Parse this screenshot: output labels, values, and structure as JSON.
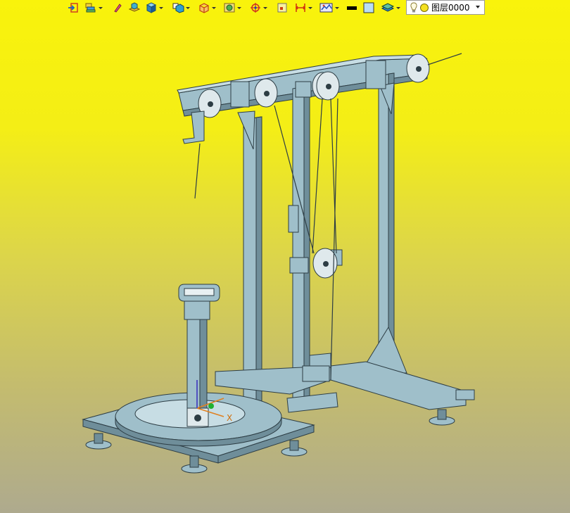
{
  "window": {
    "background_top": "#f9f30b",
    "background_bottom": "#aeaa8e"
  },
  "toolbar": {
    "items": [
      {
        "icon": "exit-sketch-icon",
        "dropdown": false
      },
      {
        "icon": "layer-manager-icon",
        "dropdown": true
      },
      {
        "icon": "pencil-icon",
        "dropdown": false
      },
      {
        "icon": "extrude-icon",
        "dropdown": false
      },
      {
        "icon": "solid-box-icon",
        "dropdown": true
      },
      {
        "icon": "shaded-view-icon",
        "dropdown": true
      },
      {
        "icon": "wireframe-view-icon",
        "dropdown": true
      },
      {
        "icon": "render-mode-icon",
        "dropdown": true
      },
      {
        "icon": "snap-target-icon",
        "dropdown": true
      },
      {
        "icon": "point-icon",
        "dropdown": false
      },
      {
        "icon": "dimension-icon",
        "dropdown": true
      },
      {
        "icon": "display-settings-icon",
        "dropdown": true
      },
      {
        "icon": "line-color-swatch",
        "dropdown": false
      },
      {
        "icon": "fill-color-swatch",
        "dropdown": false
      },
      {
        "icon": "layer-stack-icon",
        "dropdown": true
      }
    ],
    "line_color": "#000000",
    "fill_color": "#b9def5",
    "layer_combo": {
      "icons": [
        "lightbulb-icon",
        "layer-state-icon"
      ],
      "value": "图层0000"
    }
  },
  "model": {
    "description_colors": {
      "body": "#9fbfca",
      "shadow": "#5f7e8a",
      "edge": "#2d3d44"
    }
  }
}
